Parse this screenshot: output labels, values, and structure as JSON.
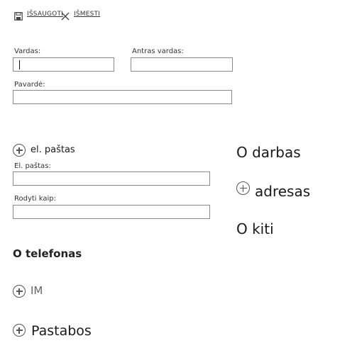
{
  "toolbar": {
    "save_label": "IŠSAUGOTI",
    "save_icon": "floppy-disk-icon",
    "discard_label": "IŠMESTI",
    "discard_icon": "close-x-icon"
  },
  "name_section": {
    "first_name_label": "Vardas:",
    "first_name_value": "",
    "middle_name_label": "Antras vardas:",
    "middle_name_value": "",
    "last_name_label": "Pavardė:",
    "last_name_value": ""
  },
  "email_section": {
    "header": "el. paštas",
    "email_label": "El. paštas:",
    "email_value": "",
    "display_as_label": "Rodyti kaip:",
    "display_as_value": ""
  },
  "phone_section": {
    "header": "O telefonas"
  },
  "im_section": {
    "header": "IM"
  },
  "notes_section": {
    "header": "Pastabos"
  },
  "work_section": {
    "header": "O darbas"
  },
  "address_section": {
    "header": "adresas"
  },
  "other_section": {
    "header": "O kiti"
  },
  "colors": {
    "text": "#1a1a1a",
    "border": "#8a8a8a",
    "icon": "#555555"
  }
}
